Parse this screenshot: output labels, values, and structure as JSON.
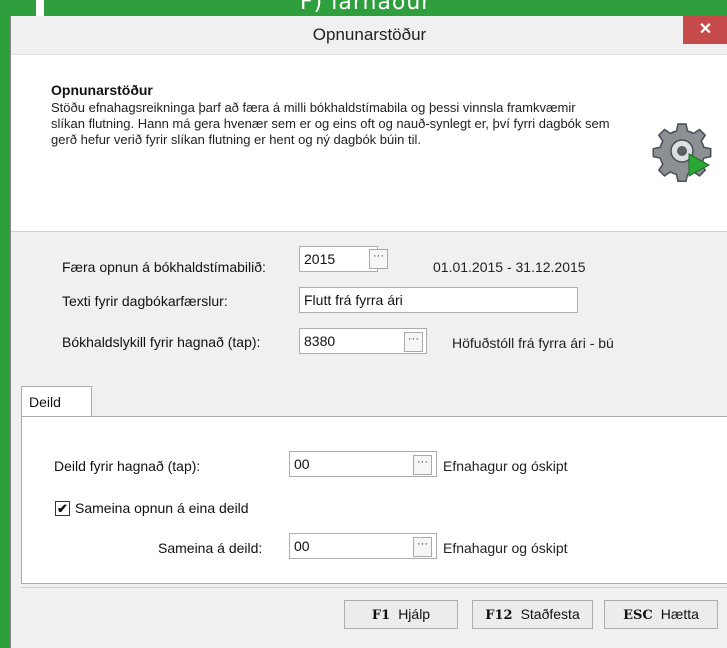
{
  "background": {
    "app_title_fragment": "F) larhaður"
  },
  "window": {
    "title": "Opnunarstöður",
    "close_glyph": "✕"
  },
  "header": {
    "title": "Opnunarstöður",
    "description": "Stöðu efnahagsreikninga þarf að færa á milli bókhaldstímabila og þessi vinnsla framkvæmir slíkan flutning.  Hann má gera hvenær sem er og eins oft og nauð-synlegt er, því fyrri dagbók sem gerð hefur verið fyrir slíkan flutning er hent og ný dagbók búin til.",
    "icon": "gear-play-icon"
  },
  "form": {
    "period": {
      "label": "Færa opnun á bókhaldstímabilið:",
      "value": "2015",
      "range": "01.01.2015 - 31.12.2015"
    },
    "text": {
      "label": "Texti fyrir dagbókarfærslur:",
      "value": "Flutt frá fyrra ári"
    },
    "account": {
      "label": "Bókhaldslykill fyrir hagnað (tap):",
      "value": "8380",
      "description": "Höfuðstóll frá fyrra ári - bú"
    }
  },
  "tabs": [
    {
      "label": "Deild",
      "active": true
    }
  ],
  "deild": {
    "profit_dept": {
      "label": "Deild fyrir hagnað (tap):",
      "value": "00",
      "description": "Efnahagur og óskipt"
    },
    "merge_checkbox": {
      "label": "Sameina opnun á eina deild",
      "checked": true,
      "mark": "✔"
    },
    "merge_dept": {
      "label": "Sameina á deild:",
      "value": "00",
      "description": "Efnahagur og óskipt"
    }
  },
  "ellipsis": "···",
  "buttons": {
    "help": {
      "key": "F1",
      "label": "Hjálp"
    },
    "confirm": {
      "key": "F12",
      "label": "Staðfesta"
    },
    "cancel": {
      "key": "ESC",
      "label": "Hætta"
    }
  },
  "colors": {
    "background_app": "#2e9f3c",
    "close_button": "#c74a4a",
    "accent_play": "#2aa836"
  }
}
